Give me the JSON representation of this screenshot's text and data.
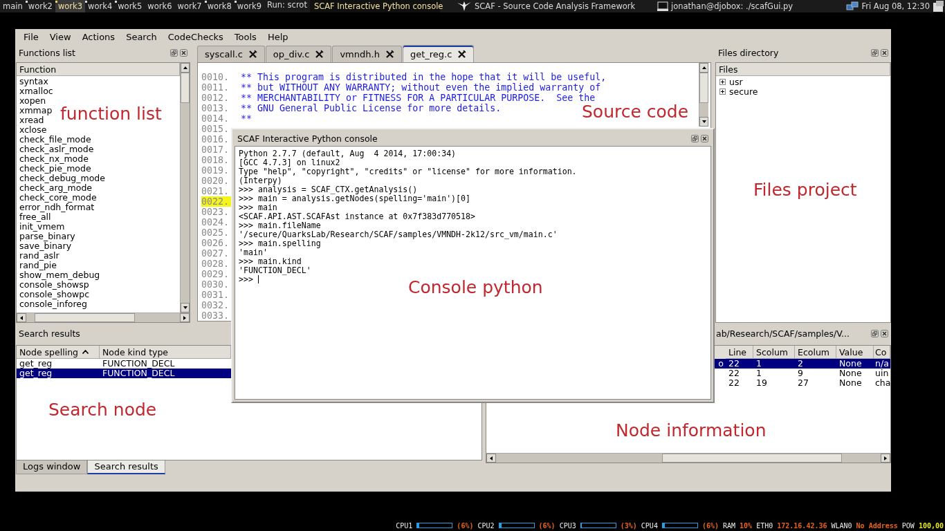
{
  "top_bar": {
    "workspaces": [
      {
        "label": "main",
        "selected": false,
        "occupied": false
      },
      {
        "label": "work2",
        "selected": false,
        "occupied": true
      },
      {
        "label": "work3",
        "selected": true,
        "occupied": true
      },
      {
        "label": "work4",
        "selected": false,
        "occupied": true
      },
      {
        "label": "work5",
        "selected": false,
        "occupied": true
      },
      {
        "label": "work6",
        "selected": false,
        "occupied": false
      },
      {
        "label": "work7",
        "selected": false,
        "occupied": false
      },
      {
        "label": "work8",
        "selected": false,
        "occupied": true
      },
      {
        "label": "work9",
        "selected": false,
        "occupied": true
      }
    ],
    "run": "Run: scrot",
    "focused_title": "SCAF Interactive Python console",
    "window_title": "SCAF - Source Code Analysis Framework",
    "terminal": "jonathan@djobox: ./scafGui.py",
    "clock": "Fri Aug 08, 12:30"
  },
  "menu": [
    "File",
    "View",
    "Actions",
    "Search",
    "CodeChecks",
    "Tools",
    "Help"
  ],
  "functions_list": {
    "title": "Functions list",
    "column": "Function",
    "items": [
      "syntax",
      "xmalloc",
      "xopen",
      "xmmap",
      "xread",
      "xclose",
      "check_file_mode",
      "check_aslr_mode",
      "check_nx_mode",
      "check_pie_mode",
      "check_debug_mode",
      "check_arg_mode",
      "check_core_mode",
      "error_ndh_format",
      "free_all",
      "init_vmem",
      "parse_binary",
      "save_binary",
      "rand_aslr",
      "rand_pie",
      "show_mem_debug",
      "console_showsp",
      "console_showpc",
      "console_inforeg"
    ]
  },
  "editor": {
    "tabs": [
      {
        "label": "syscall.c",
        "selected": false
      },
      {
        "label": "op_div.c",
        "selected": false
      },
      {
        "label": "vmndh.h",
        "selected": false
      },
      {
        "label": "get_reg.c",
        "selected": true
      }
    ],
    "lines": [
      {
        "number": "0010.",
        "code": "** This program is distributed in the hope that it will be useful,",
        "highlighted": false
      },
      {
        "number": "0011.",
        "code": "** but WITHOUT ANY WARRANTY; without even the implied warranty of",
        "highlighted": false
      },
      {
        "number": "0012.",
        "code": "** MERCHANTABILITY or FITNESS FOR A PARTICULAR PURPOSE.  See the",
        "highlighted": false
      },
      {
        "number": "0013.",
        "code": "** GNU General Public License for more details.",
        "highlighted": false
      },
      {
        "number": "0014.",
        "code": "**",
        "highlighted": false
      },
      {
        "number": "0015.",
        "highlighted": false
      },
      {
        "number": "0016.",
        "highlighted": false
      },
      {
        "number": "0017.",
        "highlighted": false
      },
      {
        "number": "0018.",
        "highlighted": false
      },
      {
        "number": "0019.",
        "highlighted": false
      },
      {
        "number": "0020.",
        "highlighted": false
      },
      {
        "number": "0021.",
        "highlighted": false
      },
      {
        "number": "0022.",
        "highlighted": true
      },
      {
        "number": "0023.",
        "highlighted": false
      },
      {
        "number": "0024.",
        "highlighted": false
      },
      {
        "number": "0025.",
        "highlighted": false
      },
      {
        "number": "0026.",
        "highlighted": false
      },
      {
        "number": "0027.",
        "highlighted": false
      },
      {
        "number": "0028.",
        "highlighted": false
      },
      {
        "number": "0029.",
        "highlighted": false
      },
      {
        "number": "0030.",
        "highlighted": false
      },
      {
        "number": "0031.",
        "highlighted": false
      },
      {
        "number": "0032.",
        "highlighted": false
      },
      {
        "number": "0033.",
        "highlighted": false
      }
    ]
  },
  "files_directory": {
    "title": "Files directory",
    "column": "Files",
    "items": [
      {
        "label": "usr",
        "expanded": false
      },
      {
        "label": "secure",
        "expanded": false
      }
    ]
  },
  "search_results": {
    "title": "Search results",
    "columns": [
      {
        "label": "Node spelling",
        "sorted": true
      },
      {
        "label": "Node kind type",
        "sorted": false
      }
    ],
    "rows": [
      {
        "cells": [
          "get_reg",
          "FUNCTION_DECL"
        ],
        "selected": false
      },
      {
        "cells": [
          "get_reg",
          "FUNCTION_DECL"
        ],
        "selected": true
      }
    ],
    "tabs": [
      {
        "label": "Logs window",
        "selected": false
      },
      {
        "label": "Search results",
        "selected": true
      }
    ]
  },
  "node_information": {
    "title": "ab/Research/SCAF/samples/V...",
    "columns": [
      "Line",
      "Scolum",
      "Ecolum",
      "Value",
      "Co"
    ],
    "rows": [
      {
        "lead": "o",
        "cells": [
          "22",
          "1",
          "2",
          "None",
          "n/a"
        ],
        "selected": true
      },
      {
        "cells": [
          "22",
          "1",
          "9",
          "None",
          "uin"
        ],
        "selected": false
      },
      {
        "cells": [
          "22",
          "19",
          "27",
          "None",
          "cha"
        ],
        "selected": false
      }
    ]
  },
  "console": {
    "title": "SCAF Interactive Python console",
    "lines": [
      "Python 2.7.7 (default, Aug  4 2014, 17:00:34)",
      "[GCC 4.7.3] on linux2",
      "Type \"help\", \"copyright\", \"credits\" or \"license\" for more information.",
      "(Interpy)",
      ">>> analysis = SCAF_CTX.getAnalysis()",
      ">>> main = analysis.getNodes(spelling='main')[0]",
      ">>> main",
      "<SCAF.API.AST.SCAFAst instance at 0x7f383d770518>",
      ">>> main.fileName",
      "'/secure/QuarksLab/Research/SCAF/samples/VMNDH-2k12/src_vm/main.c'",
      ">>> main.spelling",
      "'main'",
      ">>> main.kind",
      "'FUNCTION_DECL'"
    ],
    "prompt": ">>>"
  },
  "annotations": [
    "function list",
    "Source code",
    "Files project",
    "Console python",
    "Search node",
    "Node information"
  ],
  "status_line": [
    {
      "kind": "label",
      "text": "CPU1"
    },
    {
      "kind": "meter",
      "level": 0.06
    },
    {
      "kind": "value",
      "text": "(6%)",
      "color": "#e8641e"
    },
    {
      "kind": "label",
      "text": "CPU2"
    },
    {
      "kind": "meter",
      "level": 0.06
    },
    {
      "kind": "value",
      "text": "(6%)",
      "color": "#e8641e"
    },
    {
      "kind": "label",
      "text": "CPU3"
    },
    {
      "kind": "meter",
      "level": 0.03
    },
    {
      "kind": "value",
      "text": "(3%)",
      "color": "#e8641e"
    },
    {
      "kind": "label",
      "text": "CPU4"
    },
    {
      "kind": "meter",
      "level": 0.06
    },
    {
      "kind": "value",
      "text": "(6%)",
      "color": "#e8641e"
    },
    {
      "kind": "label",
      "text": "RAM"
    },
    {
      "kind": "value",
      "text": "10%",
      "color": "#e8641e"
    },
    {
      "kind": "label",
      "text": "ETH0"
    },
    {
      "kind": "value",
      "text": "172.16.42.36",
      "color": "#e8641e"
    },
    {
      "kind": "label",
      "text": "WLAN0"
    },
    {
      "kind": "value",
      "text": "No Address",
      "color": "#e8641e"
    },
    {
      "kind": "label",
      "text": "POW"
    },
    {
      "kind": "value",
      "text": "100,00",
      "color": "#e8e820"
    }
  ]
}
